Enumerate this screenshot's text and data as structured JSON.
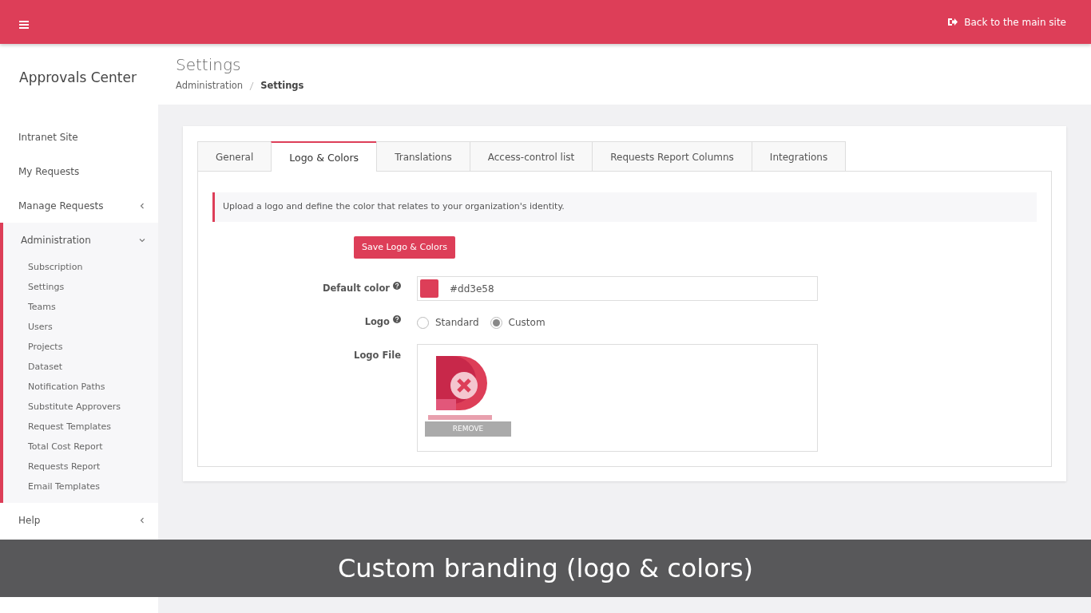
{
  "topbar": {
    "back_link": "Back to the main site"
  },
  "sidebar": {
    "title": "Approvals Center",
    "items": [
      {
        "kind": "link",
        "label": "Intranet Site"
      },
      {
        "kind": "link",
        "label": "My Requests"
      },
      {
        "kind": "group",
        "label": "Manage Requests",
        "expanded": false
      },
      {
        "kind": "group",
        "label": "Administration",
        "expanded": true,
        "children": [
          {
            "label": "Subscription"
          },
          {
            "label": "Settings"
          },
          {
            "label": "Teams"
          },
          {
            "label": "Users"
          },
          {
            "label": "Projects"
          },
          {
            "label": "Dataset"
          },
          {
            "label": "Notification Paths"
          },
          {
            "label": "Substitute Approvers"
          },
          {
            "label": "Request Templates"
          },
          {
            "label": "Total Cost Report"
          },
          {
            "label": "Requests Report"
          },
          {
            "label": "Email Templates"
          }
        ]
      },
      {
        "kind": "group",
        "label": "Help",
        "expanded": false
      }
    ]
  },
  "page": {
    "title": "Settings",
    "breadcrumb": [
      "Administration",
      "Settings"
    ]
  },
  "tabs": [
    {
      "label": "General",
      "selected": false
    },
    {
      "label": "Logo & Colors",
      "selected": true
    },
    {
      "label": "Translations",
      "selected": false
    },
    {
      "label": "Access-control list",
      "selected": false
    },
    {
      "label": "Requests Report Columns",
      "selected": false
    },
    {
      "label": "Integrations",
      "selected": false
    }
  ],
  "notice": "Upload a logo and define the color that relates to your organization's identity.",
  "save_button": "Save Logo & Colors",
  "fields": [
    {
      "kind": "color",
      "label": "Default color",
      "help": true,
      "value": "#dd3e58",
      "color": "#dd3e58"
    },
    {
      "kind": "radio",
      "label": "Logo",
      "help": true,
      "options": [
        {
          "label": "Standard",
          "selected": false
        },
        {
          "label": "Custom",
          "selected": true
        }
      ]
    },
    {
      "kind": "file",
      "label": "Logo File",
      "help": false,
      "remove_button": "REMOVE"
    }
  ],
  "caption": "Custom branding (logo & colors)"
}
